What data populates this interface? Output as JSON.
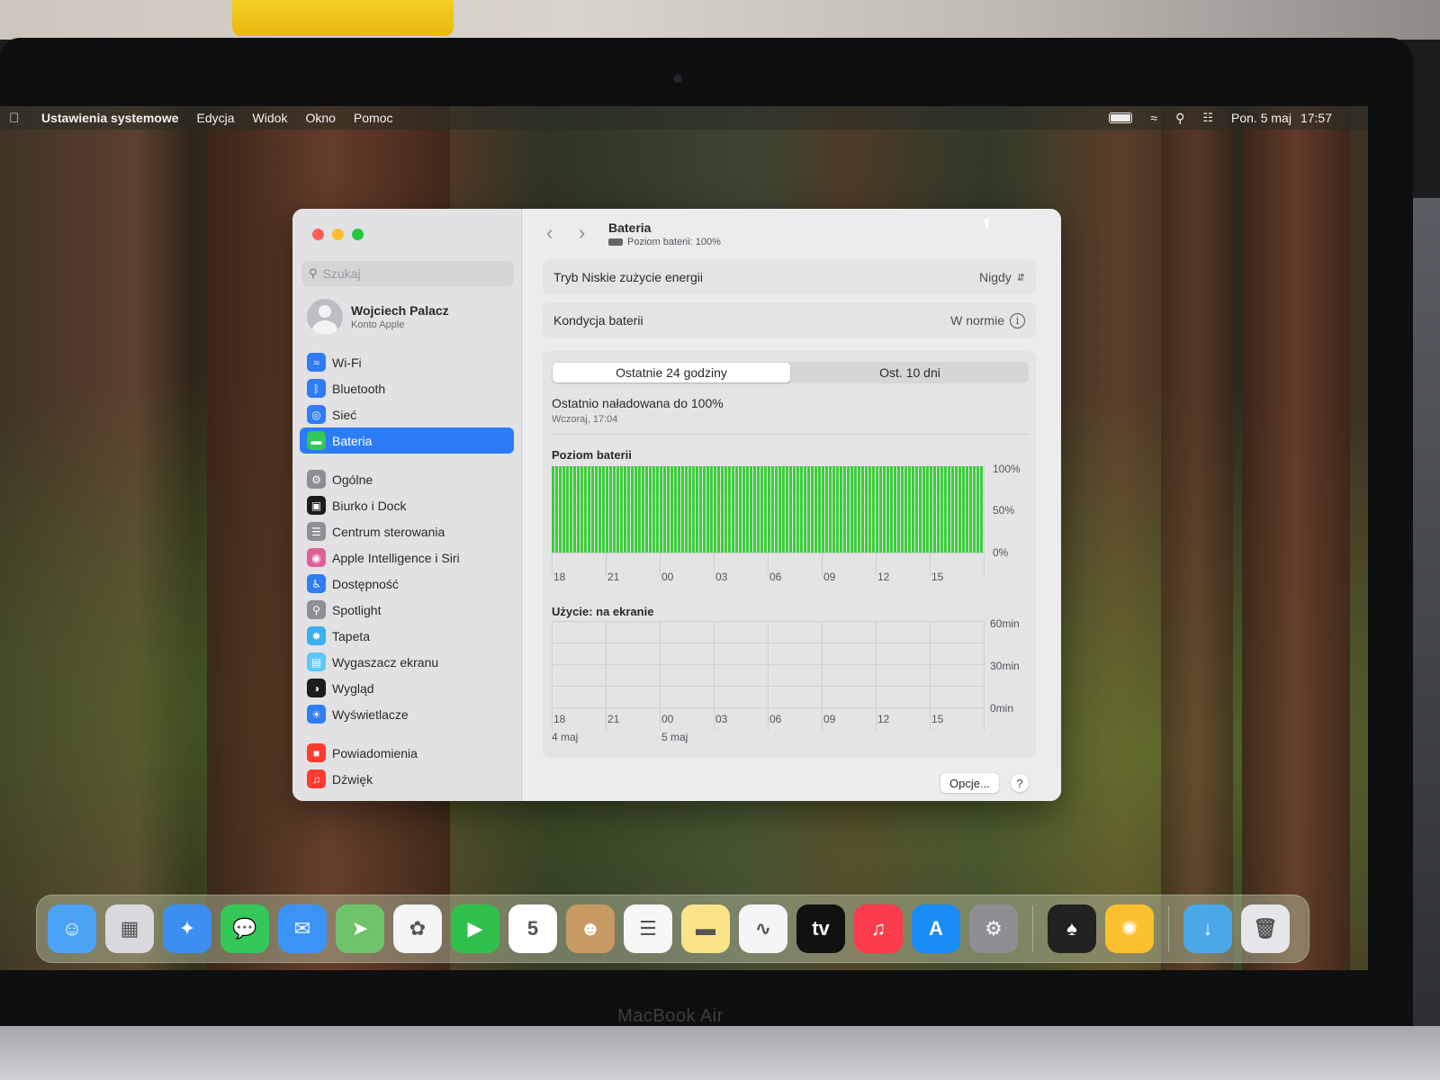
{
  "menubar": {
    "app_name": "Ustawienia systemowe",
    "menus": [
      "Edycja",
      "Widok",
      "Okno",
      "Pomoc"
    ],
    "date": "Pon. 5 maj",
    "time": "17:57"
  },
  "sidebar": {
    "search_placeholder": "Szukaj",
    "user_name": "Wojciech Palacz",
    "user_sub": "Konto Apple",
    "items": [
      {
        "label": "Wi-Fi",
        "icon": "wifi-icon",
        "color": "#2f7cf6"
      },
      {
        "label": "Bluetooth",
        "icon": "bluetooth-icon",
        "color": "#2f7cf6"
      },
      {
        "label": "Sieć",
        "icon": "globe-icon",
        "color": "#2f7cf6"
      },
      {
        "label": "Bateria",
        "icon": "battery-icon",
        "color": "#34c759"
      },
      {
        "label": "Ogólne",
        "icon": "gear-icon",
        "color": "#8e8e93"
      },
      {
        "label": "Biurko i Dock",
        "icon": "dock-icon",
        "color": "#1c1c1e"
      },
      {
        "label": "Centrum sterowania",
        "icon": "control-center-icon",
        "color": "#8e8e93"
      },
      {
        "label": "Apple Intelligence i Siri",
        "icon": "siri-icon",
        "color": "#e0609a"
      },
      {
        "label": "Dostępność",
        "icon": "accessibility-icon",
        "color": "#2f7cf6"
      },
      {
        "label": "Spotlight",
        "icon": "spotlight-icon",
        "color": "#8e8e93"
      },
      {
        "label": "Tapeta",
        "icon": "wallpaper-icon",
        "color": "#3ab0f0"
      },
      {
        "label": "Wygaszacz ekranu",
        "icon": "screensaver-icon",
        "color": "#5ac8fa"
      },
      {
        "label": "Wygląd",
        "icon": "appearance-icon",
        "color": "#1c1c1e"
      },
      {
        "label": "Wyświetlacze",
        "icon": "display-icon",
        "color": "#2f7cf6"
      },
      {
        "label": "Powiadomienia",
        "icon": "notifications-icon",
        "color": "#ff3b30"
      },
      {
        "label": "Dźwięk",
        "icon": "sound-icon",
        "color": "#ff3b30"
      }
    ]
  },
  "main": {
    "title": "Bateria",
    "subtitle": "Poziom baterii: 100%",
    "low_power_label": "Tryb Niskie zużycie energii",
    "low_power_value": "Nigdy",
    "health_label": "Kondycja baterii",
    "health_value": "W normie",
    "tabs": [
      "Ostatnie 24 godziny",
      "Ost. 10 dni"
    ],
    "charged_text": "Ostatnio naładowana do 100%",
    "charged_time": "Wczoraj, 17:04",
    "options_button": "Opcje...",
    "help_button": "?"
  },
  "charts": {
    "battery_title": "Poziom baterii",
    "battery_y_ticks": [
      "100%",
      "50%",
      "0%"
    ],
    "usage_title": "Użycie: na ekranie",
    "usage_y_ticks": [
      "60min",
      "30min",
      "0min"
    ],
    "x_ticks": [
      "18",
      "21",
      "00",
      "03",
      "06",
      "09",
      "12",
      "15"
    ],
    "date_labels": [
      "4 maj",
      "5 maj"
    ]
  },
  "chart_data": [
    {
      "type": "bar",
      "title": "Poziom baterii",
      "x_ticks": [
        "18",
        "21",
        "00",
        "03",
        "06",
        "09",
        "12",
        "15"
      ],
      "ylim": [
        0,
        100
      ],
      "values_percent": 100,
      "note_values": "all bars at 100%",
      "color": "#3ccc3c"
    },
    {
      "type": "bar",
      "title": "Użycie: na ekranie",
      "x_ticks": [
        "18",
        "21",
        "00",
        "03",
        "06",
        "09",
        "12",
        "15"
      ],
      "ylim": [
        0,
        60
      ],
      "values_min": 0
    }
  ],
  "dock": [
    {
      "name": "finder-icon",
      "color": "#4ba3f5",
      "glyph": "☺"
    },
    {
      "name": "launchpad-icon",
      "color": "#d9d9de",
      "glyph": "▦"
    },
    {
      "name": "safari-icon",
      "color": "#3c8ff0",
      "glyph": "✦"
    },
    {
      "name": "messages-icon",
      "color": "#34c759",
      "glyph": "💬"
    },
    {
      "name": "mail-icon",
      "color": "#3b94f5",
      "glyph": "✉"
    },
    {
      "name": "maps-icon",
      "color": "#6fc36a",
      "glyph": "➤"
    },
    {
      "name": "photos-icon",
      "color": "#f5f5f7",
      "glyph": "✿"
    },
    {
      "name": "facetime-icon",
      "color": "#30c14d",
      "glyph": "▶"
    },
    {
      "name": "calendar-icon",
      "color": "#ffffff",
      "glyph": "5"
    },
    {
      "name": "contacts-icon",
      "color": "#c89a63",
      "glyph": "☻"
    },
    {
      "name": "reminders-icon",
      "color": "#f7f7f7",
      "glyph": "☰"
    },
    {
      "name": "notes-icon",
      "color": "#fbe38a",
      "glyph": "▬"
    },
    {
      "name": "freeform-icon",
      "color": "#f5f5f7",
      "glyph": "∿"
    },
    {
      "name": "tv-icon",
      "color": "#111111",
      "glyph": "tv"
    },
    {
      "name": "music-icon",
      "color": "#fa3c4c",
      "glyph": "♫"
    },
    {
      "name": "appstore-icon",
      "color": "#1a8cf5",
      "glyph": "A"
    },
    {
      "name": "system-settings-icon",
      "color": "#8e8e93",
      "glyph": "⚙"
    },
    {
      "name": "bartender-icon",
      "color": "#222222",
      "glyph": "♠"
    },
    {
      "name": "tips-icon",
      "color": "#fbc02d",
      "glyph": "✺"
    },
    {
      "name": "downloads-folder-icon",
      "color": "#4aa8e8",
      "glyph": "↓"
    },
    {
      "name": "trash-icon",
      "color": "#e4e6ea",
      "glyph": "🗑"
    }
  ],
  "brand": "MacBook Air"
}
